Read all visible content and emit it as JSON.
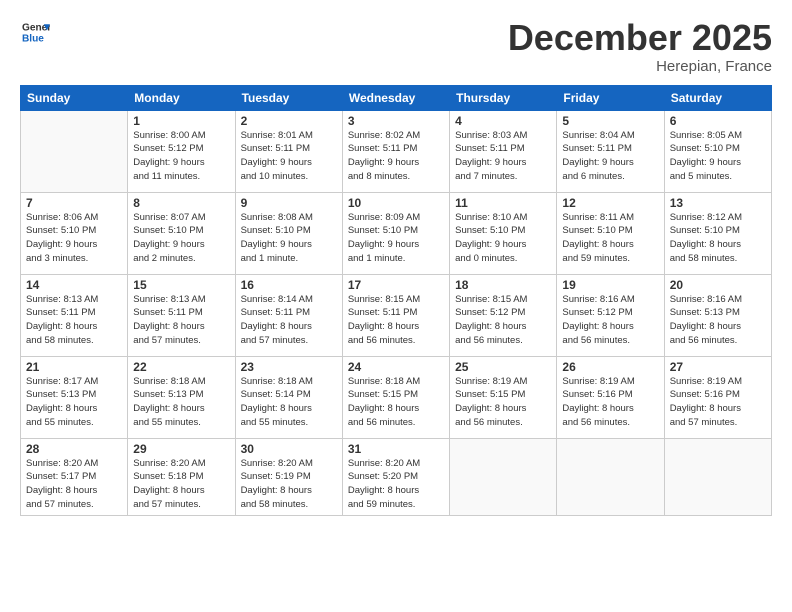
{
  "logo": {
    "line1": "General",
    "line2": "Blue"
  },
  "title": "December 2025",
  "subtitle": "Herepian, France",
  "weekdays": [
    "Sunday",
    "Monday",
    "Tuesday",
    "Wednesday",
    "Thursday",
    "Friday",
    "Saturday"
  ],
  "weeks": [
    [
      {
        "day": "",
        "info": ""
      },
      {
        "day": "1",
        "info": "Sunrise: 8:00 AM\nSunset: 5:12 PM\nDaylight: 9 hours\nand 11 minutes."
      },
      {
        "day": "2",
        "info": "Sunrise: 8:01 AM\nSunset: 5:11 PM\nDaylight: 9 hours\nand 10 minutes."
      },
      {
        "day": "3",
        "info": "Sunrise: 8:02 AM\nSunset: 5:11 PM\nDaylight: 9 hours\nand 8 minutes."
      },
      {
        "day": "4",
        "info": "Sunrise: 8:03 AM\nSunset: 5:11 PM\nDaylight: 9 hours\nand 7 minutes."
      },
      {
        "day": "5",
        "info": "Sunrise: 8:04 AM\nSunset: 5:11 PM\nDaylight: 9 hours\nand 6 minutes."
      },
      {
        "day": "6",
        "info": "Sunrise: 8:05 AM\nSunset: 5:10 PM\nDaylight: 9 hours\nand 5 minutes."
      }
    ],
    [
      {
        "day": "7",
        "info": "Sunrise: 8:06 AM\nSunset: 5:10 PM\nDaylight: 9 hours\nand 3 minutes."
      },
      {
        "day": "8",
        "info": "Sunrise: 8:07 AM\nSunset: 5:10 PM\nDaylight: 9 hours\nand 2 minutes."
      },
      {
        "day": "9",
        "info": "Sunrise: 8:08 AM\nSunset: 5:10 PM\nDaylight: 9 hours\nand 1 minute."
      },
      {
        "day": "10",
        "info": "Sunrise: 8:09 AM\nSunset: 5:10 PM\nDaylight: 9 hours\nand 1 minute."
      },
      {
        "day": "11",
        "info": "Sunrise: 8:10 AM\nSunset: 5:10 PM\nDaylight: 9 hours\nand 0 minutes."
      },
      {
        "day": "12",
        "info": "Sunrise: 8:11 AM\nSunset: 5:10 PM\nDaylight: 8 hours\nand 59 minutes."
      },
      {
        "day": "13",
        "info": "Sunrise: 8:12 AM\nSunset: 5:10 PM\nDaylight: 8 hours\nand 58 minutes."
      }
    ],
    [
      {
        "day": "14",
        "info": "Sunrise: 8:13 AM\nSunset: 5:11 PM\nDaylight: 8 hours\nand 58 minutes."
      },
      {
        "day": "15",
        "info": "Sunrise: 8:13 AM\nSunset: 5:11 PM\nDaylight: 8 hours\nand 57 minutes."
      },
      {
        "day": "16",
        "info": "Sunrise: 8:14 AM\nSunset: 5:11 PM\nDaylight: 8 hours\nand 57 minutes."
      },
      {
        "day": "17",
        "info": "Sunrise: 8:15 AM\nSunset: 5:11 PM\nDaylight: 8 hours\nand 56 minutes."
      },
      {
        "day": "18",
        "info": "Sunrise: 8:15 AM\nSunset: 5:12 PM\nDaylight: 8 hours\nand 56 minutes."
      },
      {
        "day": "19",
        "info": "Sunrise: 8:16 AM\nSunset: 5:12 PM\nDaylight: 8 hours\nand 56 minutes."
      },
      {
        "day": "20",
        "info": "Sunrise: 8:16 AM\nSunset: 5:13 PM\nDaylight: 8 hours\nand 56 minutes."
      }
    ],
    [
      {
        "day": "21",
        "info": "Sunrise: 8:17 AM\nSunset: 5:13 PM\nDaylight: 8 hours\nand 55 minutes."
      },
      {
        "day": "22",
        "info": "Sunrise: 8:18 AM\nSunset: 5:13 PM\nDaylight: 8 hours\nand 55 minutes."
      },
      {
        "day": "23",
        "info": "Sunrise: 8:18 AM\nSunset: 5:14 PM\nDaylight: 8 hours\nand 55 minutes."
      },
      {
        "day": "24",
        "info": "Sunrise: 8:18 AM\nSunset: 5:15 PM\nDaylight: 8 hours\nand 56 minutes."
      },
      {
        "day": "25",
        "info": "Sunrise: 8:19 AM\nSunset: 5:15 PM\nDaylight: 8 hours\nand 56 minutes."
      },
      {
        "day": "26",
        "info": "Sunrise: 8:19 AM\nSunset: 5:16 PM\nDaylight: 8 hours\nand 56 minutes."
      },
      {
        "day": "27",
        "info": "Sunrise: 8:19 AM\nSunset: 5:16 PM\nDaylight: 8 hours\nand 57 minutes."
      }
    ],
    [
      {
        "day": "28",
        "info": "Sunrise: 8:20 AM\nSunset: 5:17 PM\nDaylight: 8 hours\nand 57 minutes."
      },
      {
        "day": "29",
        "info": "Sunrise: 8:20 AM\nSunset: 5:18 PM\nDaylight: 8 hours\nand 57 minutes."
      },
      {
        "day": "30",
        "info": "Sunrise: 8:20 AM\nSunset: 5:19 PM\nDaylight: 8 hours\nand 58 minutes."
      },
      {
        "day": "31",
        "info": "Sunrise: 8:20 AM\nSunset: 5:20 PM\nDaylight: 8 hours\nand 59 minutes."
      },
      {
        "day": "",
        "info": ""
      },
      {
        "day": "",
        "info": ""
      },
      {
        "day": "",
        "info": ""
      }
    ]
  ]
}
